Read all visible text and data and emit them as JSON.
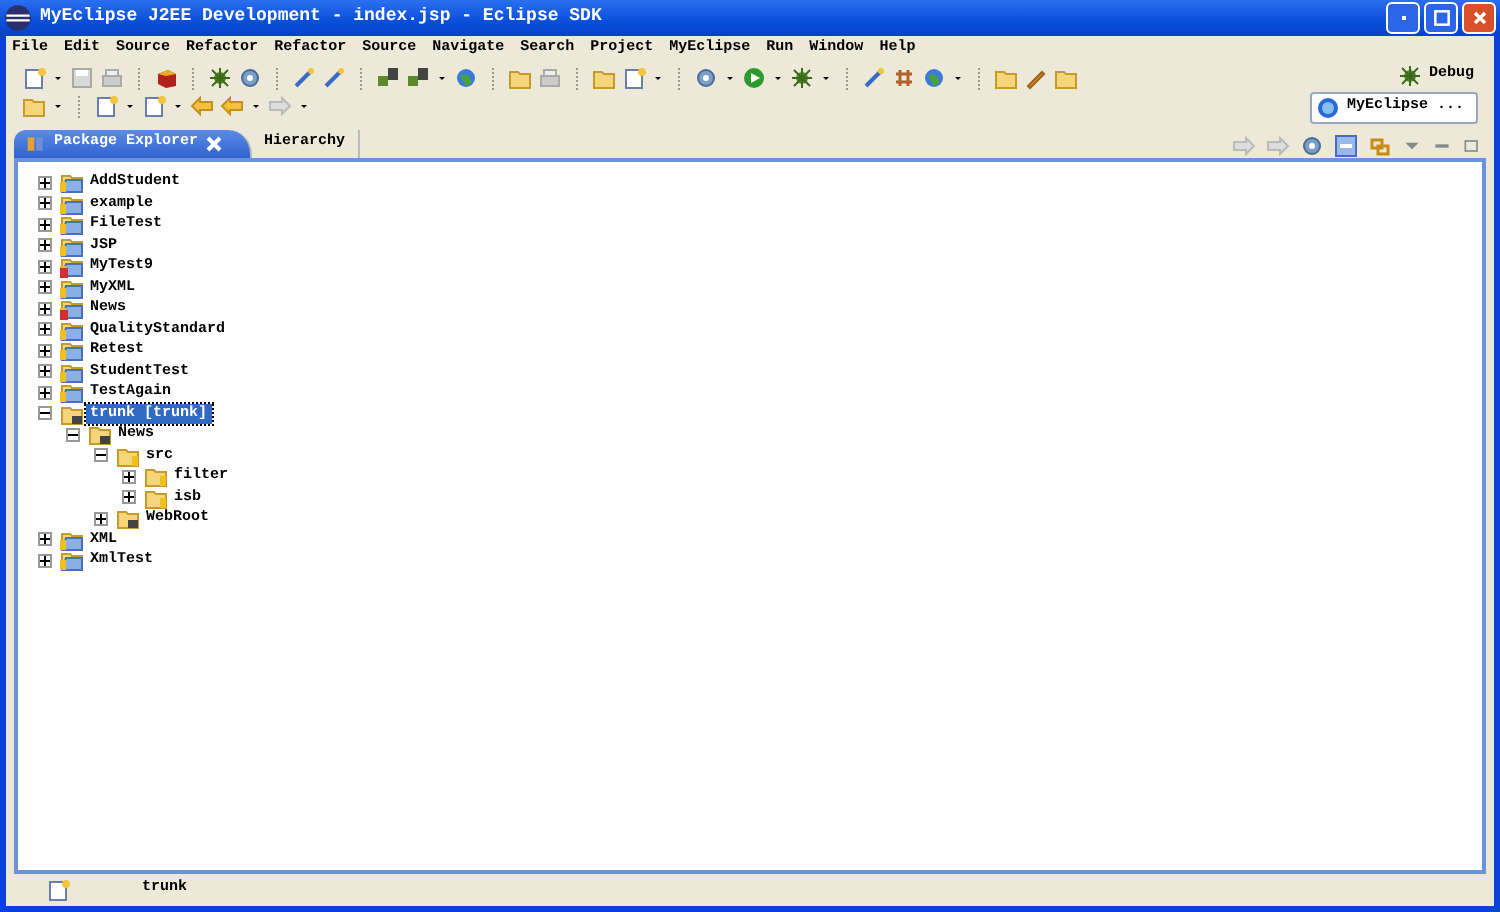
{
  "window": {
    "title": "MyEclipse J2EE Development - index.jsp - Eclipse SDK"
  },
  "menu": [
    "File",
    "Edit",
    "Source",
    "Refactor",
    "Refactor",
    "Source",
    "Navigate",
    "Search",
    "Project",
    "MyEclipse",
    "Run",
    "Window",
    "Help"
  ],
  "perspectives": [
    {
      "label": "Debug",
      "selected": false
    },
    {
      "label": "MyEclipse ...",
      "selected": true
    }
  ],
  "tabs": [
    {
      "label": "Package Explorer",
      "selected": true,
      "closable": true
    },
    {
      "label": "Hierarchy",
      "selected": false,
      "closable": false
    }
  ],
  "tree": [
    {
      "name": "AddStudent",
      "kind": "project",
      "error": false,
      "expanded": false,
      "selected": false
    },
    {
      "name": "example",
      "kind": "project",
      "error": false,
      "expanded": false,
      "selected": false
    },
    {
      "name": "FileTest",
      "kind": "project",
      "error": false,
      "expanded": false,
      "selected": false
    },
    {
      "name": "JSP",
      "kind": "project",
      "error": false,
      "expanded": false,
      "selected": false
    },
    {
      "name": "MyTest9",
      "kind": "project",
      "error": true,
      "expanded": false,
      "selected": false
    },
    {
      "name": "MyXML",
      "kind": "project",
      "error": false,
      "expanded": false,
      "selected": false
    },
    {
      "name": "News",
      "kind": "project",
      "error": true,
      "expanded": false,
      "selected": false
    },
    {
      "name": "QualityStandard",
      "kind": "project",
      "error": false,
      "expanded": false,
      "selected": false
    },
    {
      "name": "Retest",
      "kind": "project",
      "error": false,
      "expanded": false,
      "selected": false
    },
    {
      "name": "StudentTest",
      "kind": "project",
      "error": false,
      "expanded": false,
      "selected": false
    },
    {
      "name": "TestAgain",
      "kind": "project",
      "error": false,
      "expanded": false,
      "selected": false
    },
    {
      "name": "trunk [trunk]",
      "kind": "repo",
      "error": false,
      "expanded": true,
      "selected": true,
      "children": [
        {
          "name": "News",
          "kind": "repo",
          "error": false,
          "expanded": true,
          "selected": false,
          "children": [
            {
              "name": "src",
              "kind": "folder",
              "error": false,
              "expanded": true,
              "selected": false,
              "children": [
                {
                  "name": "filter",
                  "kind": "folder",
                  "error": false,
                  "expanded": false,
                  "selected": false
                },
                {
                  "name": "isb",
                  "kind": "folder",
                  "error": false,
                  "expanded": false,
                  "selected": false
                }
              ]
            },
            {
              "name": "WebRoot",
              "kind": "repo",
              "error": false,
              "expanded": false,
              "selected": false
            }
          ]
        }
      ]
    },
    {
      "name": "XML",
      "kind": "project",
      "error": false,
      "expanded": false,
      "selected": false
    },
    {
      "name": "XmlTest",
      "kind": "project",
      "error": false,
      "expanded": false,
      "selected": false
    }
  ],
  "status_bar": {
    "text": "trunk"
  }
}
